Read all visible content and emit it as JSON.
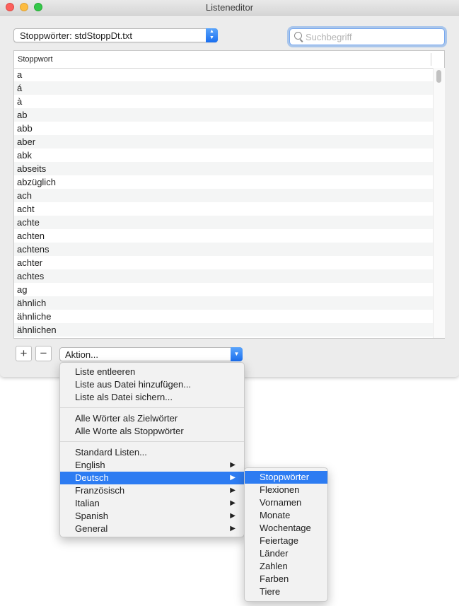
{
  "window": {
    "title": "Listeneditor"
  },
  "list_popup": {
    "label": "Stoppwörter: stdStoppDt.txt"
  },
  "search": {
    "placeholder": "Suchbegriff"
  },
  "table": {
    "column_header": "Stoppwort",
    "rows": [
      "a",
      "á",
      "à",
      "ab",
      "abb",
      "aber",
      "abk",
      "abseits",
      "abzüglich",
      "ach",
      "acht",
      "achte",
      "achten",
      "achtens",
      "achter",
      "achtes",
      "ag",
      "ähnlich",
      "ähnliche",
      "ähnlichen"
    ]
  },
  "buttons": {
    "add_label": "+",
    "remove_label": "−"
  },
  "action_popup": {
    "label": "Aktion..."
  },
  "action_menu": {
    "group1": [
      "Liste entleeren",
      "Liste aus Datei hinzufügen...",
      "Liste als Datei sichern..."
    ],
    "group2": [
      "Alle Wörter als Zielwörter",
      "Alle Worte als Stoppwörter"
    ],
    "group3": [
      {
        "label": "Standard Listen...",
        "submenu": false,
        "highlighted": false
      },
      {
        "label": "English",
        "submenu": true,
        "highlighted": false
      },
      {
        "label": "Deutsch",
        "submenu": true,
        "highlighted": true
      },
      {
        "label": "Französisch",
        "submenu": true,
        "highlighted": false
      },
      {
        "label": "Italian",
        "submenu": true,
        "highlighted": false
      },
      {
        "label": "Spanish",
        "submenu": true,
        "highlighted": false
      },
      {
        "label": "General",
        "submenu": true,
        "highlighted": false
      }
    ]
  },
  "submenu": {
    "items": [
      {
        "label": "Stoppwörter",
        "highlighted": true
      },
      {
        "label": "Flexionen",
        "highlighted": false
      },
      {
        "label": "Vornamen",
        "highlighted": false
      },
      {
        "label": "Monate",
        "highlighted": false
      },
      {
        "label": "Wochentage",
        "highlighted": false
      },
      {
        "label": "Feiertage",
        "highlighted": false
      },
      {
        "label": "Länder",
        "highlighted": false
      },
      {
        "label": "Zahlen",
        "highlighted": false
      },
      {
        "label": "Farben",
        "highlighted": false
      },
      {
        "label": "Tiere",
        "highlighted": false
      }
    ]
  },
  "colors": {
    "accent": "#2d7cf2",
    "window_bg": "#ececec"
  }
}
